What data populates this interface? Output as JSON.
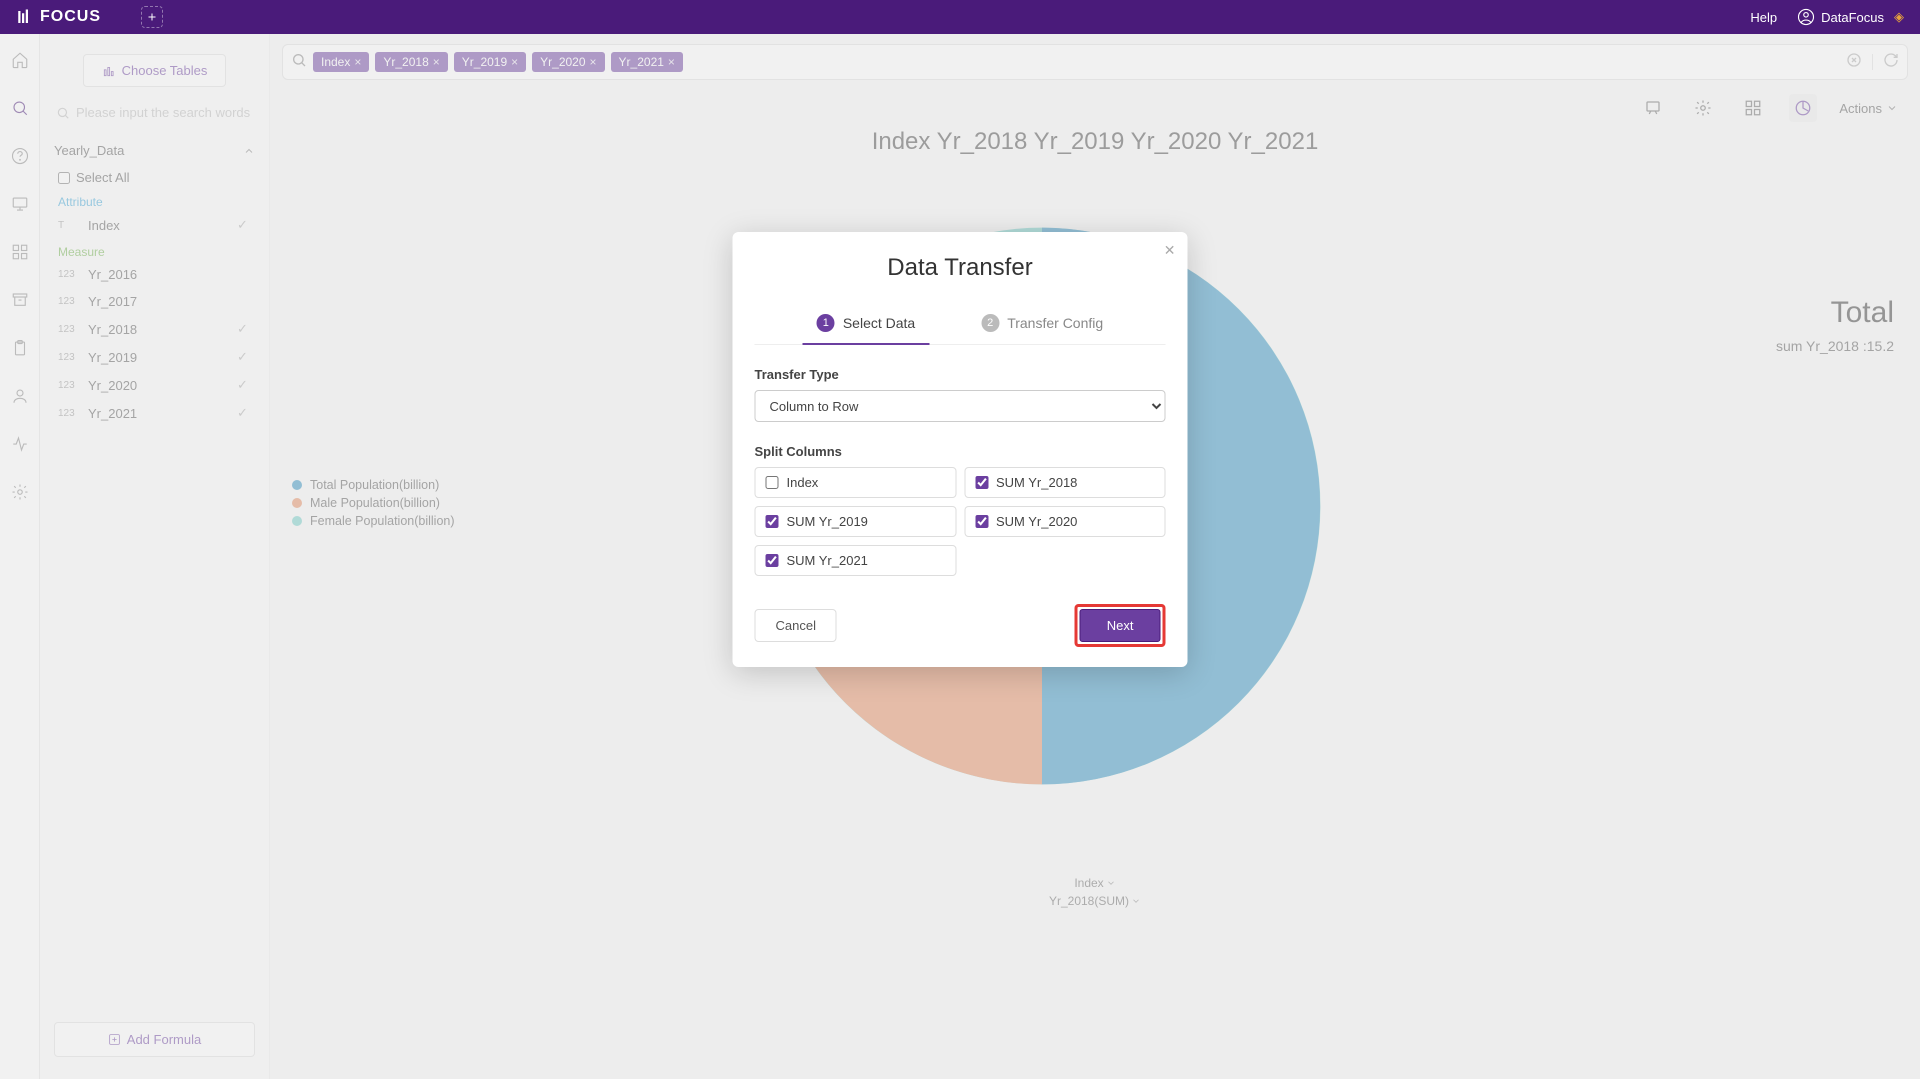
{
  "app": {
    "name": "FOCUS",
    "help": "Help",
    "user": "DataFocus"
  },
  "rail": {
    "items": [
      "home",
      "search",
      "help",
      "present",
      "grid",
      "archive",
      "clipboard",
      "user",
      "activity",
      "settings"
    ]
  },
  "side": {
    "choose_tables": "Choose Tables",
    "search_placeholder": "Please input the search words",
    "group": "Yearly_Data",
    "select_all": "Select All",
    "attribute_label": "Attribute",
    "measure_label": "Measure",
    "attributes": [
      {
        "type": "T",
        "name": "Index",
        "checked": true
      }
    ],
    "measures": [
      {
        "type": "123",
        "name": "Yr_2016",
        "checked": false
      },
      {
        "type": "123",
        "name": "Yr_2017",
        "checked": false
      },
      {
        "type": "123",
        "name": "Yr_2018",
        "checked": true
      },
      {
        "type": "123",
        "name": "Yr_2019",
        "checked": true
      },
      {
        "type": "123",
        "name": "Yr_2020",
        "checked": true
      },
      {
        "type": "123",
        "name": "Yr_2021",
        "checked": true
      }
    ],
    "add_formula": "Add Formula"
  },
  "query": {
    "pills": [
      "Index",
      "Yr_2018",
      "Yr_2019",
      "Yr_2020",
      "Yr_2021"
    ]
  },
  "chart": {
    "title": "Index Yr_2018 Yr_2019 Yr_2020 Yr_2021",
    "legend": [
      {
        "color": "#2e8fbf",
        "label": "Total Population(billion)"
      },
      {
        "color": "#e58a5e",
        "label": "Male Population(billion)"
      },
      {
        "color": "#6fccc6",
        "label": "Female Population(billion)"
      }
    ],
    "right": {
      "title": "Total",
      "sub": "sum Yr_2018 :15.2"
    },
    "axis": {
      "a": "Index",
      "b": "Yr_2018(SUM)"
    },
    "actions_label": "Actions"
  },
  "modal": {
    "title": "Data Transfer",
    "step1": "Select Data",
    "step2": "Transfer Config",
    "transfer_type_label": "Transfer Type",
    "transfer_type_value": "Column to Row",
    "split_label": "Split Columns",
    "splits": [
      {
        "label": "Index",
        "checked": false
      },
      {
        "label": "SUM Yr_2018",
        "checked": true
      },
      {
        "label": "SUM Yr_2019",
        "checked": true
      },
      {
        "label": "SUM Yr_2020",
        "checked": true
      },
      {
        "label": "SUM Yr_2021",
        "checked": true
      }
    ],
    "cancel": "Cancel",
    "next": "Next"
  },
  "colors": {
    "brand": "#6b3fa0",
    "brand_dark": "#4a1b7a"
  },
  "chart_data": {
    "type": "pie",
    "title": "Index Yr_2018 Yr_2019 Yr_2020 Yr_2021",
    "value_label": "sum Yr_2018",
    "total": 15.2,
    "slices": [
      {
        "name": "Total Population(billion)",
        "value": 7.6,
        "color": "#2e8fbf"
      },
      {
        "name": "Male Population(billion)",
        "value": 3.85,
        "color": "#e58a5e"
      },
      {
        "name": "Female Population(billion)",
        "value": 3.75,
        "color": "#6fccc6"
      }
    ]
  }
}
